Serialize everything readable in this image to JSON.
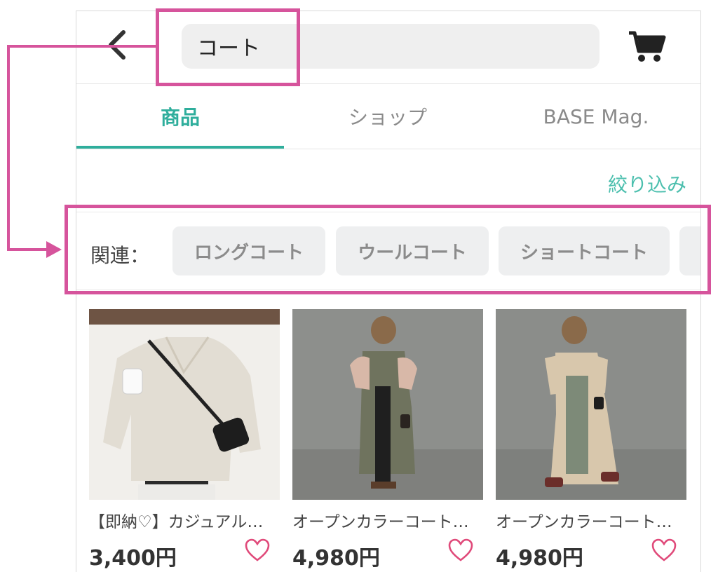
{
  "search": {
    "value": "コート"
  },
  "tabs": [
    {
      "label": "商品",
      "active": true
    },
    {
      "label": "ショップ",
      "active": false
    },
    {
      "label": "BASE Mag.",
      "active": false
    }
  ],
  "filter_label": "絞り込み",
  "related": {
    "label": "関連：",
    "chips": [
      "ロングコート",
      "ウールコート",
      "ショートコート"
    ]
  },
  "products": [
    {
      "title": "【即納♡】カジュアル…",
      "price": "3,400円"
    },
    {
      "title": "オープンカラーコート…",
      "price": "4,980円"
    },
    {
      "title": "オープンカラーコート…",
      "price": "4,980円"
    }
  ],
  "colors": {
    "accent": "#2fae9c",
    "annotation": "#d6549c",
    "heart": "#e04a7a"
  },
  "icons": [
    "back-arrow-icon",
    "cart-icon",
    "heart-icon"
  ]
}
